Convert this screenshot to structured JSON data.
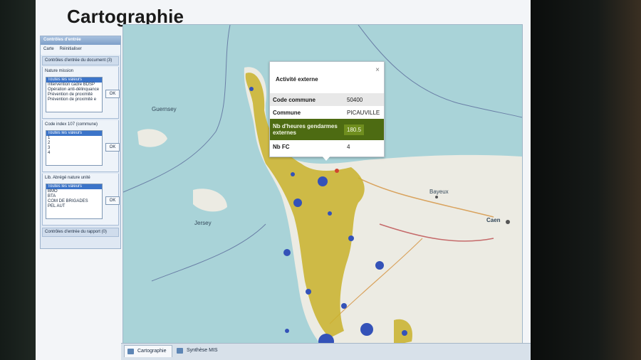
{
  "page": {
    "title": "Cartographie"
  },
  "panel": {
    "header": "Contrôles d'entrée",
    "toolbar": {
      "carte": "Carte",
      "reinit": "Réinitialiser"
    },
    "doc_controls": "Contrôles d'entrée du document (3)",
    "filters": [
      {
        "label": "Nature mission",
        "ok": "OK",
        "options": [
          "Toutes les valeurs",
          "Intervention cadre BDSP",
          "Opération anti-délinquance",
          "Prévention de proximité",
          "Prévention de proximité e"
        ]
      },
      {
        "label": "Code index 107 (commune)",
        "ok": "OK",
        "options": [
          "Toutes les valeurs",
          "1",
          "2",
          "3",
          "4"
        ]
      },
      {
        "label": "Lib. Abrégé nature unité",
        "ok": "OK",
        "options": [
          "Toutes les valeurs",
          "BMO",
          "BTA",
          "COM DE BRIGADES",
          "PEL AUT"
        ]
      }
    ],
    "report_controls": "Contrôles d'entrée du rapport (0)"
  },
  "map": {
    "places": {
      "guernsey": "Guernsey",
      "jersey": "Jersey",
      "bayeux": "Bayeux",
      "caen": "Caen"
    },
    "popup": {
      "title": "Activité externe",
      "close": "×",
      "rows": [
        {
          "key": "Code commune",
          "value": "50400"
        },
        {
          "key": "Commune",
          "value": "PICAUVILLE"
        },
        {
          "key": "Nb d'heures gendarmes externes",
          "value": "180.5"
        },
        {
          "key": "Nb FC",
          "value": "4"
        }
      ]
    }
  },
  "tabs": [
    {
      "label": "Cartographie",
      "active": true
    },
    {
      "label": "Synthèse MIS",
      "active": false
    }
  ]
}
